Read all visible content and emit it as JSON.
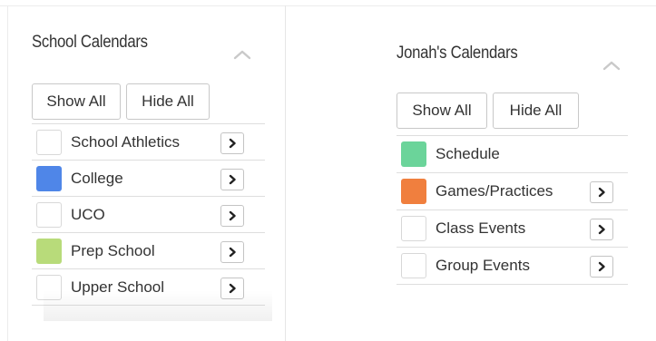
{
  "colors": {
    "college": "#4f86e8",
    "prep_school": "#b8db7a",
    "schedule": "#6bd49a",
    "games_practices": "#f07f3e"
  },
  "school_calendars": {
    "title": "School Calendars",
    "collapse_icon": "chevron-up-icon",
    "show_all_label": "Show All",
    "hide_all_label": "Hide All",
    "items": [
      {
        "label": "School Athletics",
        "color": "",
        "checked": false,
        "has_arrow": true
      },
      {
        "label": "College",
        "color": "#4f86e8",
        "checked": true,
        "has_arrow": true
      },
      {
        "label": "UCO",
        "color": "",
        "checked": false,
        "has_arrow": true
      },
      {
        "label": "Prep School",
        "color": "#b8db7a",
        "checked": true,
        "has_arrow": true
      },
      {
        "label": "Upper School",
        "color": "",
        "checked": false,
        "has_arrow": true
      }
    ]
  },
  "jonahs_calendars": {
    "title": "Jonah's Calendars",
    "collapse_icon": "chevron-up-icon",
    "show_all_label": "Show All",
    "hide_all_label": "Hide All",
    "items": [
      {
        "label": "Schedule",
        "color": "#6bd49a",
        "checked": true,
        "has_arrow": false
      },
      {
        "label": "Games/Practices",
        "color": "#f07f3e",
        "checked": true,
        "has_arrow": true
      },
      {
        "label": "Class Events",
        "color": "",
        "checked": false,
        "has_arrow": true
      },
      {
        "label": "Group Events",
        "color": "",
        "checked": false,
        "has_arrow": true
      }
    ]
  }
}
